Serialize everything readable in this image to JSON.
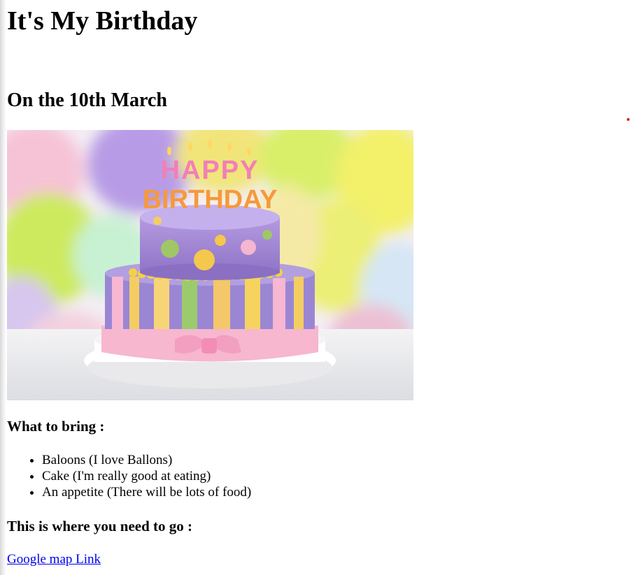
{
  "page": {
    "title": "It's My Birthday",
    "date_heading": "On the 10th March",
    "bring_heading": "What to bring :",
    "bring_items": [
      "Baloons (I love Ballons)",
      "Cake (I'm really good at eating)",
      "An appetite (There will be lots of food)"
    ],
    "where_heading": "This is where you need to go :",
    "map_link_label": "Google map Link"
  },
  "image": {
    "subject": "birthday-cake-with-balloons",
    "candle_letters_top": "HAPPY",
    "candle_letters_bottom": "BIRTHDAY"
  },
  "colors": {
    "link": "#0000ee",
    "text": "#000000",
    "background": "#ffffff"
  }
}
